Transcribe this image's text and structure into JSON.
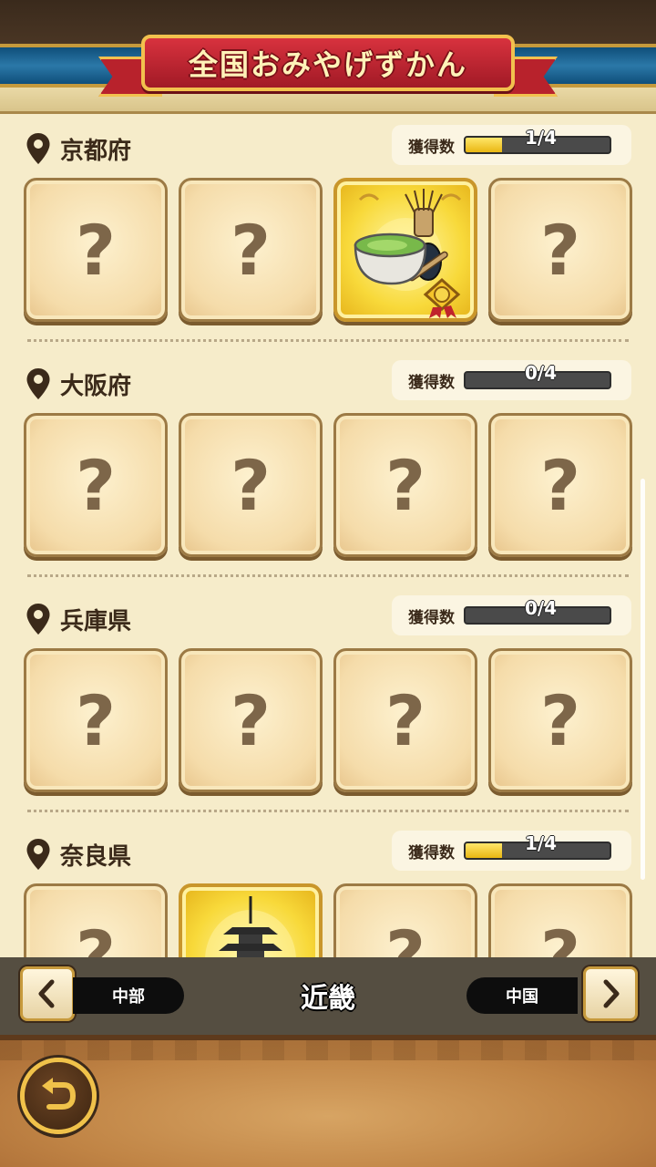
{
  "header": {
    "title": "全国おみやげずかん"
  },
  "content": {
    "count_label": "獲得数",
    "sections": [
      {
        "name": "京都府",
        "count_text": "1/4",
        "progress": 0.25,
        "cards": [
          "?",
          "?",
          "matcha-bowl-and-whisk",
          "?"
        ]
      },
      {
        "name": "大阪府",
        "count_text": "0/4",
        "progress": 0,
        "cards": [
          "?",
          "?",
          "?",
          "?"
        ]
      },
      {
        "name": "兵庫県",
        "count_text": "0/4",
        "progress": 0,
        "cards": [
          "?",
          "?",
          "?",
          "?"
        ]
      },
      {
        "name": "奈良県",
        "count_text": "1/4",
        "progress": 0.25,
        "cards": [
          "?",
          "pagoda",
          "?",
          "?"
        ]
      }
    ]
  },
  "region_nav": {
    "prev": "中部",
    "current": "近畿",
    "next": "中国"
  },
  "colors": {
    "accent_red": "#b8222c",
    "gold": "#f2c14e",
    "progress_fill": "#f5d031"
  }
}
